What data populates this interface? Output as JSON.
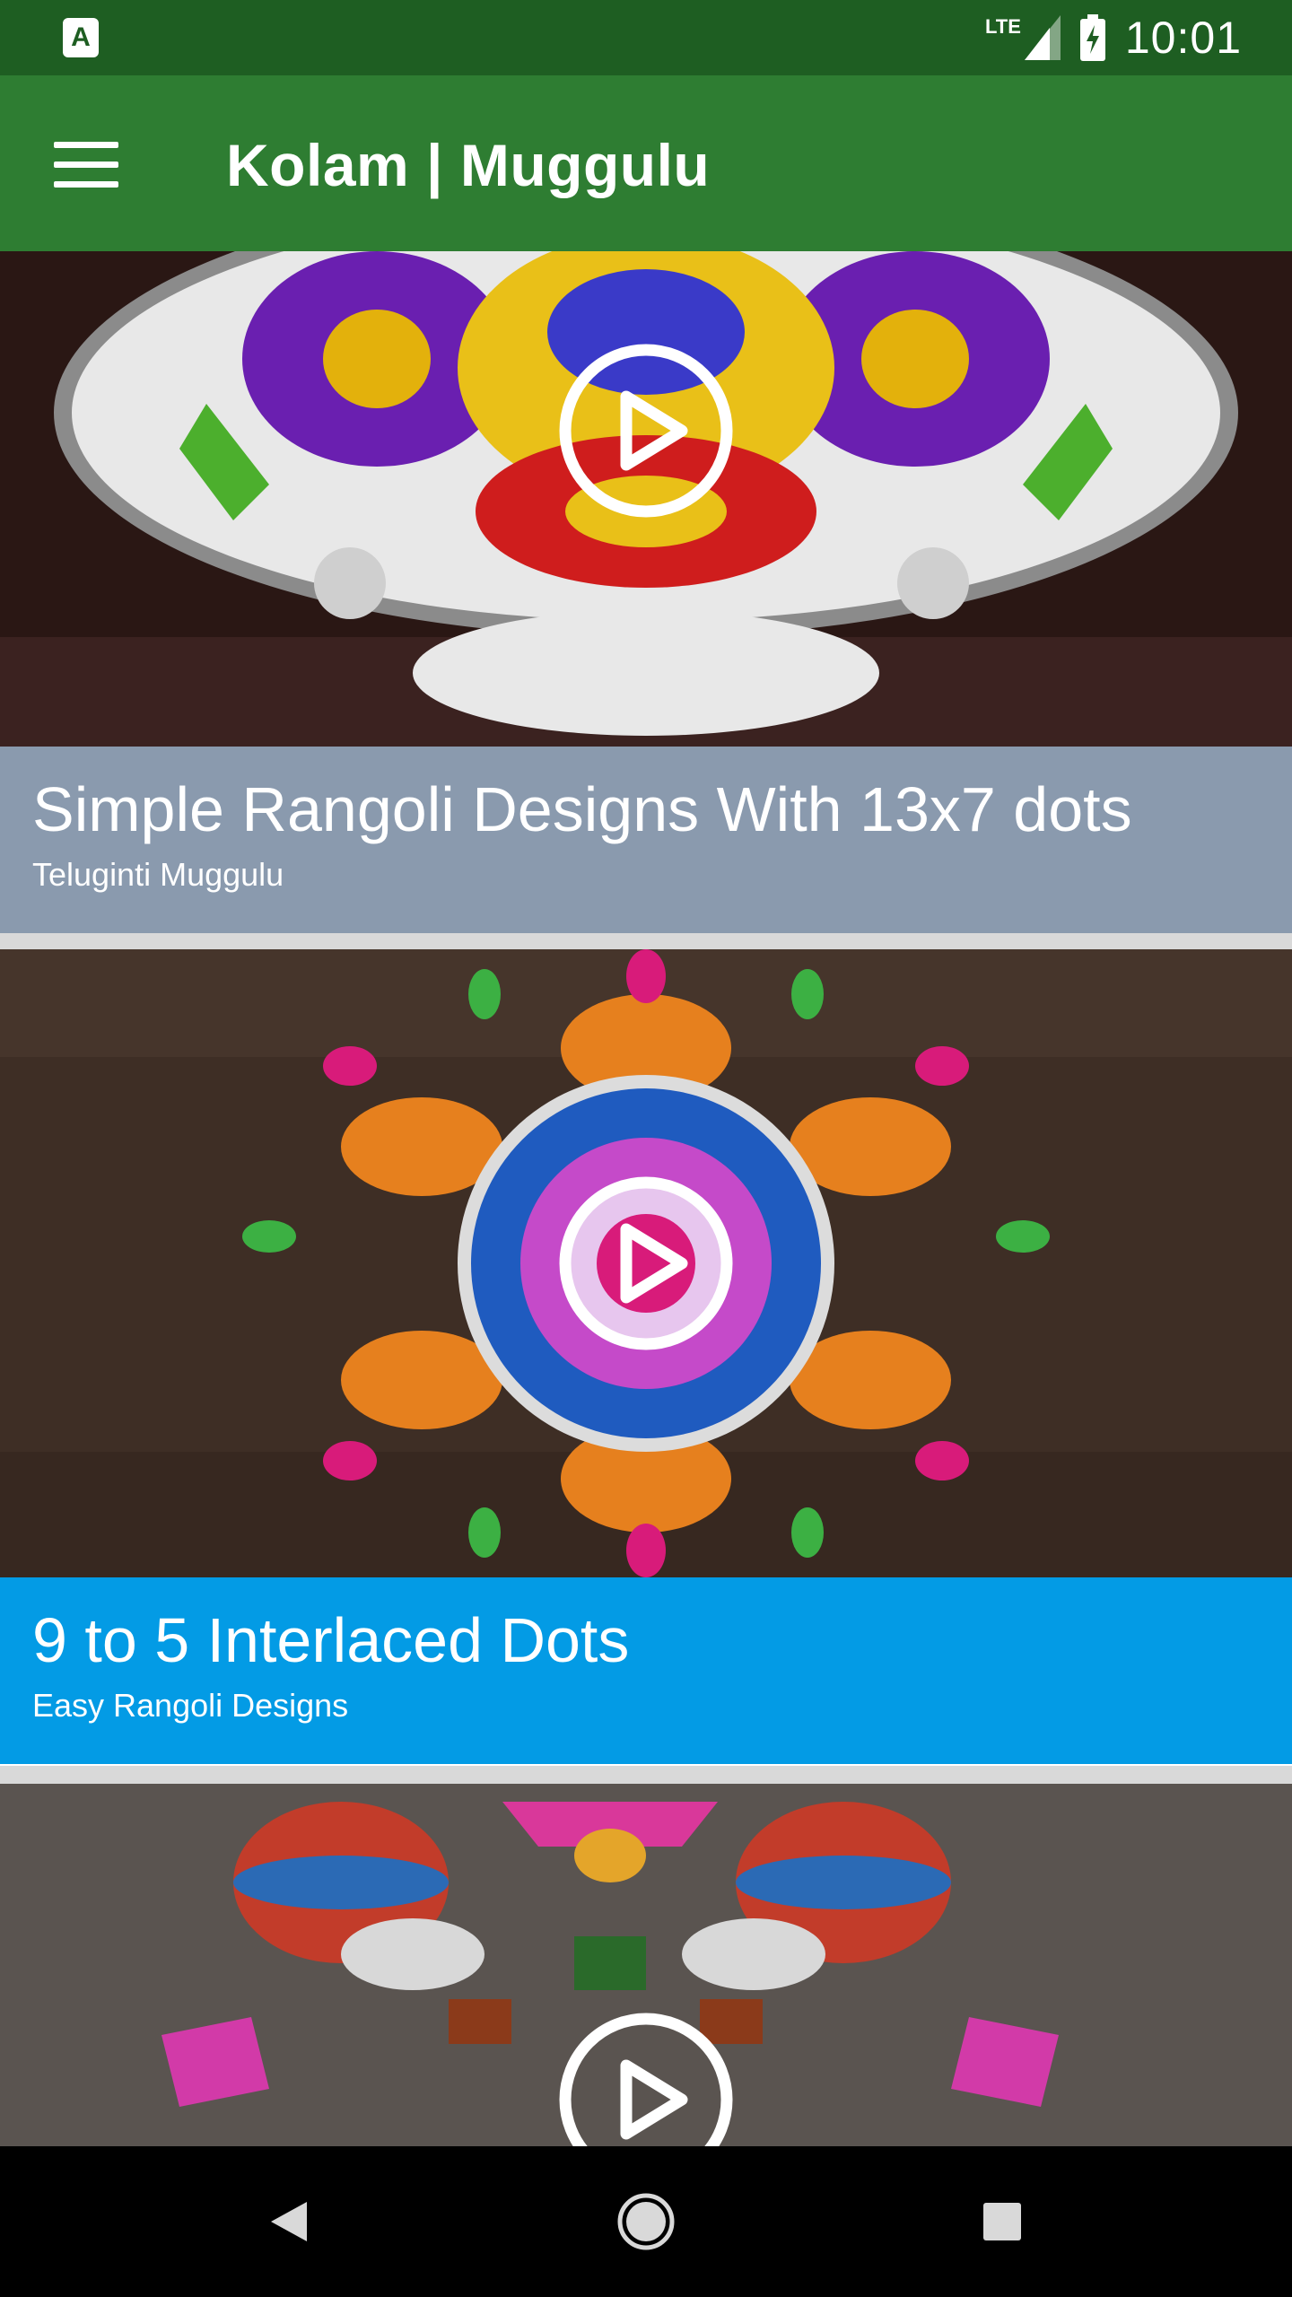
{
  "status_bar": {
    "app_badge": "A",
    "network": "LTE",
    "time": "10:01"
  },
  "app_bar": {
    "title": "Kolam | Muggulu",
    "menu_icon": "hamburger-menu-icon"
  },
  "videos": [
    {
      "title": "Simple Rangoli Designs With 13x7 dots",
      "channel": "Teluginti Muggulu",
      "caption_color": "#8a9aae"
    },
    {
      "title": "9 to 5 Interlaced Dots",
      "channel": "Easy Rangoli Designs",
      "caption_color": "#039be5"
    },
    {
      "title": "",
      "channel": "",
      "caption_color": ""
    }
  ],
  "colors": {
    "status_bar": "#1e5e22",
    "app_bar": "#2e7d32",
    "nav_bar": "#000000"
  },
  "navigation": {
    "back": "back-triangle-icon",
    "home": "home-circle-icon",
    "recents": "recents-square-icon"
  }
}
